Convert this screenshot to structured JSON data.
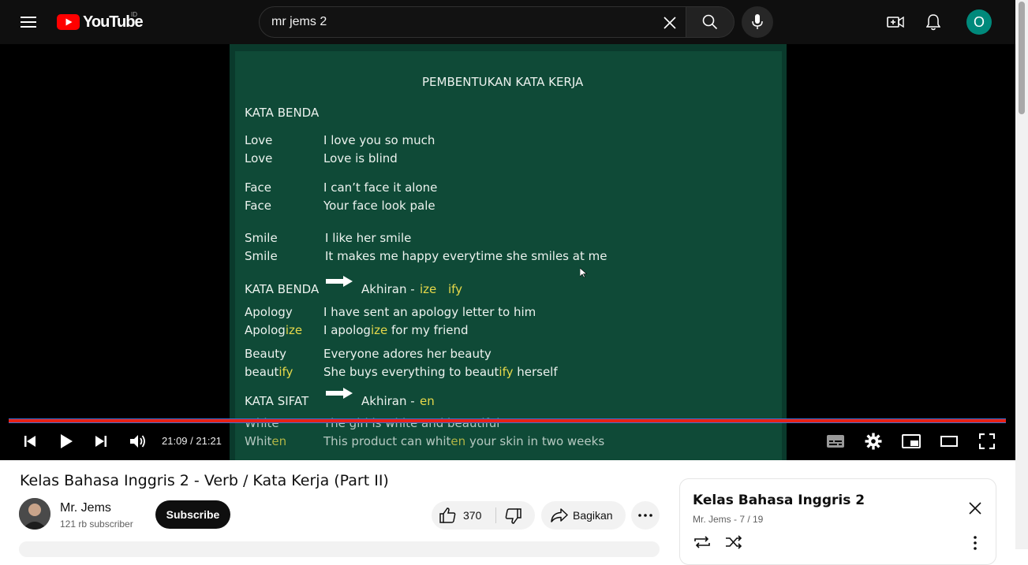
{
  "header": {
    "logo_text": "YouTube",
    "country_code": "ID",
    "search_value": "mr jems 2",
    "avatar_letter": "O"
  },
  "player": {
    "time": "21:09 / 21:21",
    "progress_fraction": 0.991,
    "slide": {
      "title": "PEMBENTUKAN KATA KERJA",
      "section1": "KATA BENDA",
      "rows1": [
        {
          "word": "Love",
          "sentence": "I love you so much"
        },
        {
          "word": "Love",
          "sentence": "Love is blind"
        },
        {
          "word": "Face",
          "sentence": "I can’t face it alone"
        },
        {
          "word": "Face",
          "sentence": "Your face look pale"
        },
        {
          "word": "Smile",
          "sentence": "I like her smile"
        },
        {
          "word": "Smile",
          "sentence": "It makes me happy everytime she smiles at me"
        }
      ],
      "section2": "KATA BENDA",
      "section2_suffix_label": "Akhiran -",
      "section2_suffix1": "ize",
      "section2_suffix2": "ify",
      "rows2": {
        "apology_word": "Apology",
        "apology_sentence": "I have sent an apology letter to him",
        "apologize_stem": "Apolog",
        "apologize_suffix": "ize",
        "apologize_s1": "I apolog",
        "apologize_s2": "ize",
        "apologize_s3": " for my friend",
        "beauty_word": "Beauty",
        "beauty_sentence": "Everyone adores her beauty",
        "beautify_stem": "beaut",
        "beautify_suffix": "ify",
        "beautify_s1": "She buys everything to beaut",
        "beautify_s2": "ify",
        "beautify_s3": " herself"
      },
      "section3": "KATA SIFAT",
      "section3_suffix_label": "Akhiran -",
      "section3_suffix": "en",
      "rows3": {
        "white_word": "White",
        "white_sentence": "The girl is white and beautiful",
        "whiten_stem": "Whit",
        "whiten_suffix": "en",
        "whiten_s1": "This product can whit",
        "whiten_s2": "en",
        "whiten_s3": " your skin in two weeks"
      }
    }
  },
  "video": {
    "title": "Kelas Bahasa Inggris 2 - Verb / Kata Kerja (Part II)",
    "channel_name": "Mr. Jems",
    "subscribers": "121 rb subscriber",
    "subscribe_label": "Subscribe",
    "like_count": "370",
    "share_label": "Bagikan"
  },
  "playlist": {
    "title": "Kelas Bahasa Inggris 2",
    "meta": "Mr. Jems - 7 / 19"
  },
  "colors": {
    "youtube_red": "#ff0000",
    "progress_red": "#e62117",
    "slide_green": "#0f4a37",
    "highlight_yellow": "#e6d84a",
    "avatar_teal": "#00897b"
  }
}
